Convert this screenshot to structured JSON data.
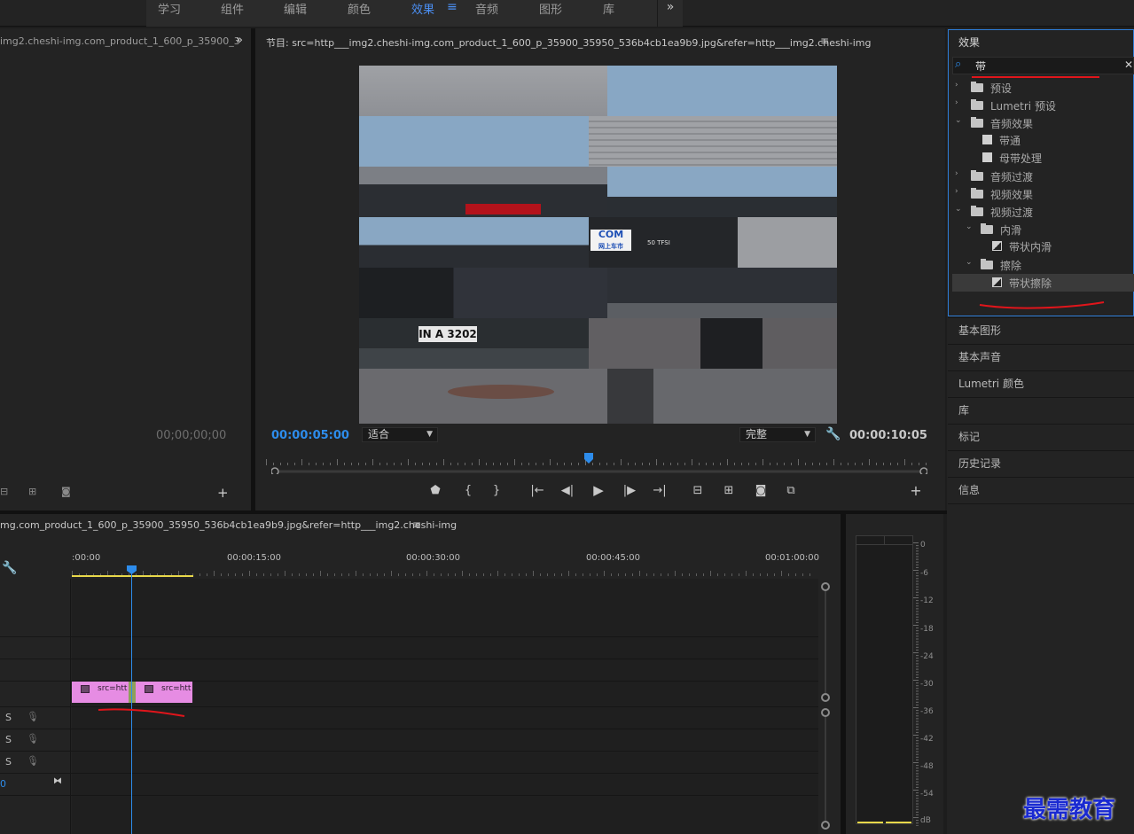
{
  "workspaces": {
    "items": [
      "学习",
      "组件",
      "编辑",
      "颜色",
      "效果",
      "音频",
      "图形",
      "库"
    ],
    "active": "效果",
    "more": "»"
  },
  "source": {
    "tab": "img2.cheshi-img.com_product_1_600_p_35900_3",
    "timecode": "00;00;00;00"
  },
  "program": {
    "title": "节目: src=http___img2.cheshi-img.com_product_1_600_p_35900_35950_536b4cb1ea9b9.jpg&refer=http___img2.cheshi-img",
    "timecode": "00:00:05:00",
    "fit": "适合",
    "quality": "完整",
    "duration": "00:00:10:05",
    "plate_text": "IN A 3202",
    "badge_text": "COM",
    "badge_sub": "网上车市",
    "car_badge": "50 TFSI"
  },
  "timeline": {
    "title": "mg.com_product_1_600_p_35900_35950_536b4cb1ea9b9.jpg&refer=http___img2.cheshi-img",
    "ruler_labels": [
      ":00:00",
      "00:00:15:00",
      "00:00:30:00",
      "00:00:45:00",
      "00:01:00:00"
    ],
    "clips": [
      {
        "label": "src=htt"
      },
      {
        "label": "src=htt"
      }
    ],
    "track_s": "S",
    "track_o": "0"
  },
  "meter": {
    "scale": [
      "0",
      "-6",
      "-12",
      "-18",
      "-24",
      "-30",
      "-36",
      "-42",
      "-48",
      "-54",
      "dB"
    ]
  },
  "effects": {
    "title": "效果",
    "search_value": "带",
    "tree": [
      {
        "label": "预设",
        "icon": "folder-icon",
        "expanded": false
      },
      {
        "label": "Lumetri 预设",
        "icon": "folder-icon",
        "expanded": false
      },
      {
        "label": "音频效果",
        "icon": "folder-icon",
        "expanded": true
      },
      {
        "label": "带通",
        "icon": "audio-effect-icon"
      },
      {
        "label": "母带处理",
        "icon": "audio-effect-icon"
      },
      {
        "label": "音频过渡",
        "icon": "folder-icon",
        "expanded": false
      },
      {
        "label": "视频效果",
        "icon": "folder-icon",
        "expanded": false
      },
      {
        "label": "视频过渡",
        "icon": "folder-icon",
        "expanded": true
      },
      {
        "label": "内滑",
        "icon": "folder-icon",
        "expanded": true
      },
      {
        "label": "带状内滑",
        "icon": "transition-icon"
      },
      {
        "label": "擦除",
        "icon": "folder-icon",
        "expanded": true
      },
      {
        "label": "带状擦除",
        "icon": "transition-icon",
        "selected": true
      }
    ]
  },
  "panels": [
    "基本图形",
    "基本声音",
    "Lumetri 颜色",
    "库",
    "标记",
    "历史记录",
    "信息"
  ],
  "watermark": "最需教育",
  "colors": {
    "accent_blue": "#2d8ceb",
    "clip_pink": "#e68ce3",
    "annotation_red": "#e0151b",
    "work_area_yellow": "#e8d84a"
  }
}
